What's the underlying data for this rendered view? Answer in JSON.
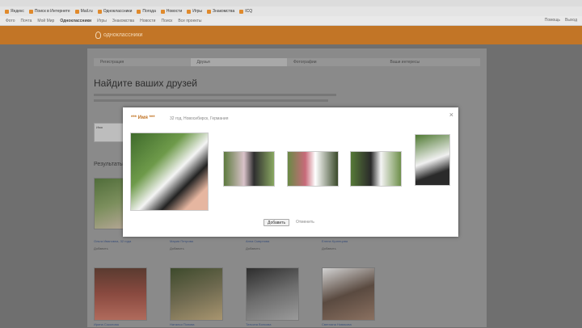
{
  "browser": {
    "bookmarks": [
      {
        "label": "Яндекс",
        "icon": "yandex-icon"
      },
      {
        "label": "Поиск в Интернете",
        "icon": "search-icon"
      },
      {
        "label": "Mail.ru",
        "icon": "mail-icon"
      },
      {
        "label": "Одноклассники",
        "icon": "ok-icon"
      },
      {
        "label": "Погода",
        "icon": "weather-icon"
      },
      {
        "label": "Новости",
        "icon": "news-icon"
      },
      {
        "label": "Игры",
        "icon": "games-icon"
      },
      {
        "label": "Знакомства",
        "icon": "dating-icon"
      },
      {
        "label": "ICQ",
        "icon": "icq-icon"
      }
    ],
    "brand_color": "#c27526"
  },
  "nav": {
    "links": [
      "Фото",
      "Почта",
      "Мой Мир",
      "Одноклассники",
      "Игры",
      "Знакомства",
      "Новости",
      "Поиск",
      "Все проекты"
    ],
    "active_index": 3,
    "right": [
      "Помощь",
      "Выход"
    ]
  },
  "site": {
    "logo_text": "одноклассники"
  },
  "page": {
    "steps": [
      "Регистрация",
      "Друзья",
      "Фотографии",
      "Ваши интересы"
    ],
    "current_step": 1,
    "title": "Найдите ваших друзей",
    "results_title": "Результаты поиска",
    "search_label": "Имя"
  },
  "results": [
    {
      "line1": "Ольга Ивановна, 32 года",
      "line2": "Добавить"
    },
    {
      "line1": "Мария Петрова",
      "line2": "Добавить"
    },
    {
      "line1": "Анна Смирнова",
      "line2": "Добавить"
    },
    {
      "line1": "Елена Кузнецова",
      "line2": "Добавить"
    },
    {
      "line1": "Ирина Соколова",
      "line2": ""
    },
    {
      "line1": "Наталья Попова",
      "line2": ""
    },
    {
      "line1": "Татьяна Волкова",
      "line2": ""
    },
    {
      "line1": "Светлана Новикова",
      "line2": ""
    }
  ],
  "modal": {
    "name": "*** Имя ***",
    "meta": "32 год, Новосибирск, Германия",
    "close_glyph": "×",
    "add_label": "Добавить",
    "cancel_label": "Отменить"
  }
}
